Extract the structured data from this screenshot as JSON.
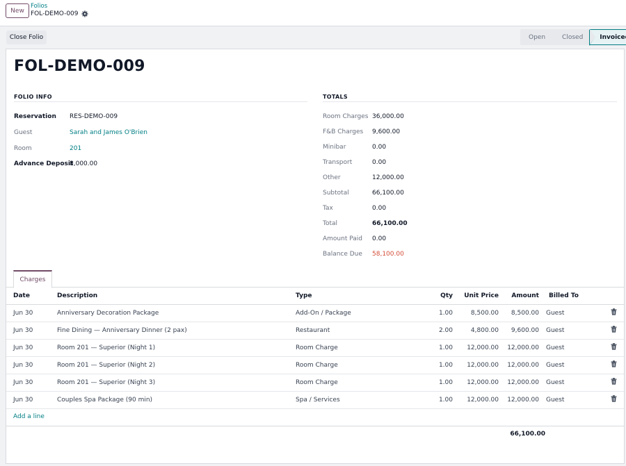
{
  "header": {
    "new_label": "New",
    "breadcrumb_parent": "Folios",
    "breadcrumb_current": "FOL-DEMO-009"
  },
  "actions": {
    "close_folio_label": "Close Folio"
  },
  "status": {
    "stages": [
      "Open",
      "Closed",
      "Invoiced"
    ],
    "active": "Invoiced"
  },
  "record": {
    "title": "FOL-DEMO-009"
  },
  "folio_info": {
    "section_title": "FOLIO INFO",
    "fields": [
      {
        "label": "Reservation",
        "value": "RES-DEMO-009"
      },
      {
        "label": "Guest",
        "value": "Sarah and James O'Brien"
      },
      {
        "label": "Room",
        "value": "201"
      },
      {
        "label": "Advance Deposit",
        "value": "8,000.00"
      }
    ]
  },
  "totals": {
    "section_title": "TOTALS",
    "fields": [
      {
        "label": "Room Charges",
        "value": "36,000.00"
      },
      {
        "label": "F&B Charges",
        "value": "9,600.00"
      },
      {
        "label": "Minibar",
        "value": "0.00"
      },
      {
        "label": "Transport",
        "value": "0.00"
      },
      {
        "label": "Other",
        "value": "12,000.00"
      },
      {
        "label": "Subtotal",
        "value": "66,100.00"
      },
      {
        "label": "Tax",
        "value": "0.00"
      },
      {
        "label": "Total",
        "value": "66,100.00"
      },
      {
        "label": "Amount Paid",
        "value": "0.00"
      },
      {
        "label": "Balance Due",
        "value": "58,100.00"
      }
    ]
  },
  "tabs": [
    {
      "label": "Charges"
    }
  ],
  "charges": {
    "columns": [
      "Date",
      "Description",
      "Type",
      "Qty",
      "Unit Price",
      "Amount",
      "Billed To"
    ],
    "rows": [
      {
        "date": "Jun 30",
        "description": "Anniversary Decoration Package",
        "type": "Add-On / Package",
        "qty": "1.00",
        "unit_price": "8,500.00",
        "amount": "8,500.00",
        "billed_to": "Guest"
      },
      {
        "date": "Jun 30",
        "description": "Fine Dining — Anniversary Dinner (2 pax)",
        "type": "Restaurant",
        "qty": "2.00",
        "unit_price": "4,800.00",
        "amount": "9,600.00",
        "billed_to": "Guest"
      },
      {
        "date": "Jun 30",
        "description": "Room 201 — Superior (Night 1)",
        "type": "Room Charge",
        "qty": "1.00",
        "unit_price": "12,000.00",
        "amount": "12,000.00",
        "billed_to": "Guest"
      },
      {
        "date": "Jun 30",
        "description": "Room 201 — Superior (Night 2)",
        "type": "Room Charge",
        "qty": "1.00",
        "unit_price": "12,000.00",
        "amount": "12,000.00",
        "billed_to": "Guest"
      },
      {
        "date": "Jun 30",
        "description": "Room 201 — Superior (Night 3)",
        "type": "Room Charge",
        "qty": "1.00",
        "unit_price": "12,000.00",
        "amount": "12,000.00",
        "billed_to": "Guest"
      },
      {
        "date": "Jun 30",
        "description": "Couples Spa Package (90 min)",
        "type": "Spa / Services",
        "qty": "1.00",
        "unit_price": "12,000.00",
        "amount": "12,000.00",
        "billed_to": "Guest"
      }
    ],
    "add_line_label": "Add a line",
    "total_amount": "66,100.00"
  },
  "colors": {
    "brand": "#714b67",
    "link": "#017e84",
    "danger": "#d44c36"
  }
}
